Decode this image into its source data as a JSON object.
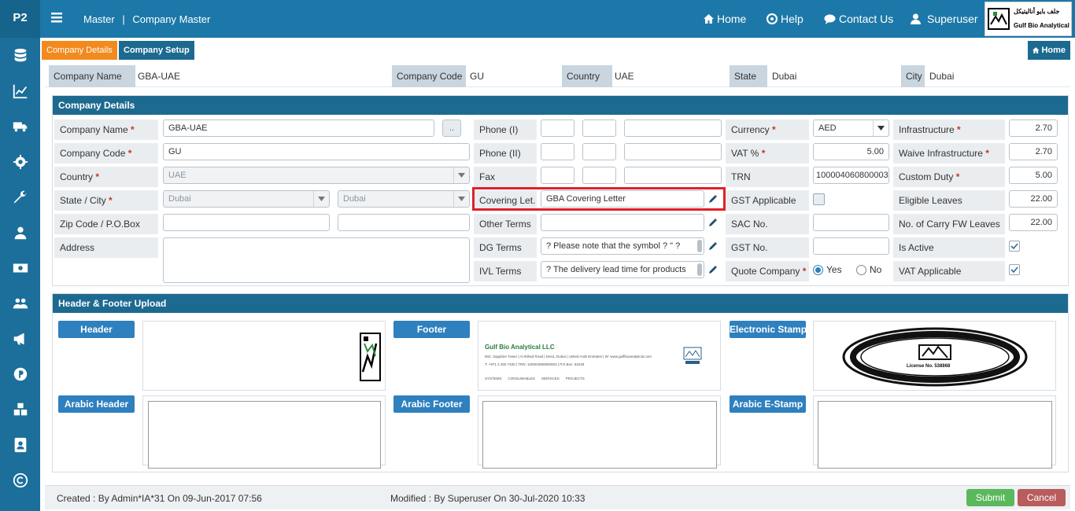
{
  "app": {
    "brand": "P2"
  },
  "topbar": {
    "crumb_master": "Master",
    "crumb_sep": "|",
    "crumb_page": "Company Master",
    "home": "Home",
    "help": "Help",
    "contact": "Contact Us",
    "user": "Superuser",
    "logo_arabic": "جلف بايو أناليتيكل",
    "logo_text": "Gulf Bio Analytical"
  },
  "tabs": {
    "company_details": "Company Details",
    "company_setup": "Company Setup",
    "home": "Home"
  },
  "summary": {
    "company_name_label": "Company Name",
    "company_name": "GBA-UAE",
    "company_code_label": "Company Code",
    "company_code": "GU",
    "country_label": "Country",
    "country": "UAE",
    "state_label": "State",
    "state": "Dubai",
    "city_label": "City",
    "city": "Dubai"
  },
  "details": {
    "title": "Company Details",
    "company_name_label": "Company Name",
    "company_name": "GBA-UAE",
    "ellipsis": "..",
    "company_code_label": "Company Code",
    "company_code": "GU",
    "country_label": "Country",
    "country": "UAE",
    "state_city_label": "State / City",
    "state": "Dubai",
    "city": "Dubai",
    "zip_label": "Zip Code / P.O.Box",
    "address_label": "Address",
    "phone1_label": "Phone (I)",
    "phone2_label": "Phone (II)",
    "fax_label": "Fax",
    "covering_label": "Covering Let.",
    "covering_value": "GBA Covering Letter",
    "other_terms_label": "Other Terms",
    "dg_terms_label": "DG Terms",
    "dg_terms_value": "?    Please note that the symbol ? \" ?",
    "ivl_terms_label": "IVL Terms",
    "ivl_terms_value": "?    The delivery lead time for products",
    "currency_label": "Currency",
    "currency": "AED",
    "vat_label": "VAT %",
    "vat": "5.00",
    "trn_label": "TRN",
    "trn": "100004060800003",
    "gst_applicable_label": "GST Applicable",
    "sac_label": "SAC No.",
    "gst_no_label": "GST No.",
    "quote_label": "Quote Company",
    "yes": "Yes",
    "no": "No",
    "infra_label": "Infrastructure",
    "infra": "2.70",
    "waive_label": "Waive Infrastructure",
    "waive": "2.70",
    "custom_label": "Custom Duty",
    "custom": "5.00",
    "eligible_label": "Eligible Leaves",
    "eligible": "22.00",
    "carry_label": "No. of Carry FW Leaves",
    "carry": "22.00",
    "active_label": "Is Active",
    "vat_app_label": "VAT Applicable"
  },
  "upload": {
    "title": "Header & Footer Upload",
    "header": "Header",
    "footer": "Footer",
    "estamp": "Electronic Stamp",
    "arabic_header": "Arabic Header",
    "arabic_footer": "Arabic Footer",
    "arabic_estamp": "Arabic E-Stamp",
    "footer_company": "Gulf Bio Analytical LLC",
    "footer_line1": "902, Sapphire Tower | Al Ittihad Road | Deira, Dubai | United Arab Emirates | W: www.gulfbioanalytical.com",
    "footer_line2": "T: +971 4 250 7400 | TRN: 100004060800003 | P.O.Box: 53448",
    "footer_tags": [
      "SYSTEMS",
      "CONSUMABLES",
      "SERVICES",
      "PROJECTS"
    ],
    "stamp_text": "Gulf Bio Analytical LLC",
    "stamp_license": "License No. 538868"
  },
  "footer": {
    "created": "Created : By Admin*IA*31 On 09-Jun-2017 07:56",
    "modified": "Modified : By Superuser On 30-Jul-2020 10:33",
    "submit": "Submit",
    "cancel": "Cancel"
  },
  "colors": {
    "accent": "#1c78a8",
    "highlight": "#e0202a",
    "orange": "#f28a1e",
    "submit": "#5cb85c",
    "cancel": "#b85c5c"
  }
}
